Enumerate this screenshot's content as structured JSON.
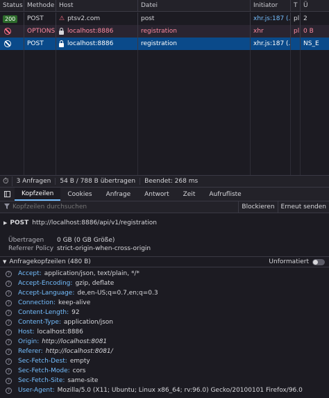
{
  "columns": [
    "Status",
    "Methode",
    "Host",
    "Datei",
    "Initiator",
    "T",
    "Ü"
  ],
  "requests": [
    {
      "status": "200",
      "method": "POST",
      "host": "ptsv2.com",
      "file": "post",
      "initiator": "xhr.js:187 (...",
      "type": "pl",
      "transferred": "2"
    },
    {
      "status": "",
      "method": "OPTIONS",
      "host": "localhost:8886",
      "file": "registration",
      "initiator": "xhr",
      "type": "pl",
      "transferred": "0 B"
    },
    {
      "status": "",
      "method": "POST",
      "host": "localhost:8886",
      "file": "registration",
      "initiator": "xhr.js:187 (...",
      "type": "",
      "transferred": "NS_E"
    }
  ],
  "summary": {
    "requests": "3 Anfragen",
    "transferred": "54 B / 788 B übertragen",
    "finished": "Beendet: 268 ms"
  },
  "tabs": [
    "Kopfzeilen",
    "Cookies",
    "Anfrage",
    "Antwort",
    "Zeit",
    "Aufrufliste"
  ],
  "filter": {
    "placeholder": "Kopfzeilen durchsuchen",
    "block_label": "Blockieren",
    "resend_label": "Erneut senden"
  },
  "request_line": {
    "method": "POST",
    "url": "http://localhost:8886/api/v1/registration"
  },
  "info": [
    {
      "label": "Übertragen",
      "value": "0 GB (0 GB Größe)"
    },
    {
      "label": "Referrer Policy",
      "value": "strict-origin-when-cross-origin"
    }
  ],
  "request_headers": {
    "title": "Anfragekopfzeilen (480 B)",
    "raw_label": "Unformatiert",
    "items": [
      {
        "name": "Accept:",
        "value": "application/json, text/plain, */*"
      },
      {
        "name": "Accept-Encoding:",
        "value": "gzip, deflate"
      },
      {
        "name": "Accept-Language:",
        "value": "de,en-US;q=0.7,en;q=0.3"
      },
      {
        "name": "Connection:",
        "value": "keep-alive"
      },
      {
        "name": "Content-Length:",
        "value": "92"
      },
      {
        "name": "Content-Type:",
        "value": "application/json"
      },
      {
        "name": "Host:",
        "value": "localhost:8886"
      },
      {
        "name": "Origin:",
        "value": "http://localhost:8081"
      },
      {
        "name": "Referer:",
        "value": "http://localhost:8081/"
      },
      {
        "name": "Sec-Fetch-Dest:",
        "value": "empty"
      },
      {
        "name": "Sec-Fetch-Mode:",
        "value": "cors"
      },
      {
        "name": "Sec-Fetch-Site:",
        "value": "same-site"
      },
      {
        "name": "User-Agent:",
        "value": "Mozilla/5.0 (X11; Ubuntu; Linux x86_64; rv:96.0) Gecko/20100101 Firefox/96.0"
      }
    ]
  },
  "colors": {
    "accent": "#75bfff",
    "selected_row": "#0a4a8a",
    "error": "#ff6f86",
    "ok": "#2c6a2a"
  }
}
